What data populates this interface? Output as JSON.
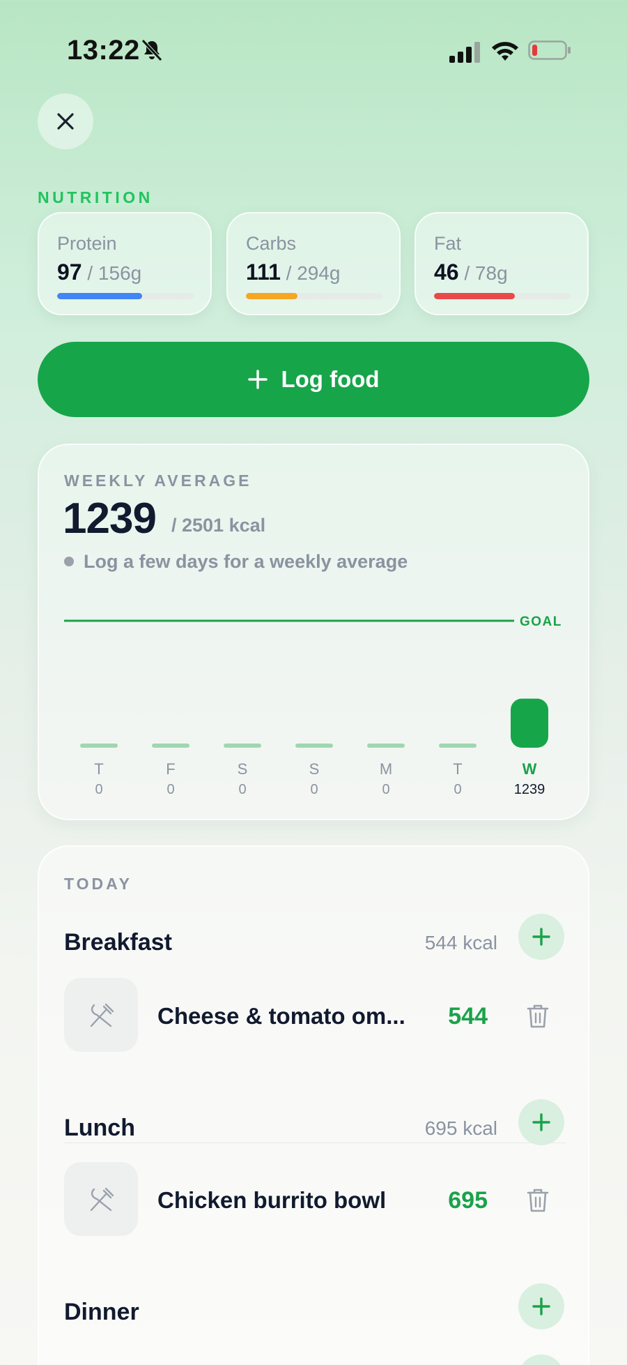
{
  "status_bar": {
    "time": "13:22"
  },
  "nutrition": {
    "label": "NUTRITION",
    "macros": [
      {
        "name": "Protein",
        "current": "97",
        "goal": " / 156g",
        "progress": 0.62,
        "color": "#4285f4"
      },
      {
        "name": "Carbs",
        "current": "111",
        "goal": " / 294g",
        "progress": 0.38,
        "color": "#f5a623"
      },
      {
        "name": "Fat",
        "current": "46",
        "goal": " / 78g",
        "progress": 0.59,
        "color": "#e84a4a"
      }
    ]
  },
  "log_food": {
    "label": "Log food"
  },
  "weekly": {
    "label": "WEEKLY AVERAGE",
    "value": "1239",
    "goal_text": "/ 2501 kcal",
    "hint": "Log a few days for a weekly average",
    "goal_marker": "GOAL",
    "chart_data": {
      "type": "bar",
      "categories": [
        "T",
        "F",
        "S",
        "S",
        "M",
        "T",
        "W"
      ],
      "values": [
        0,
        0,
        0,
        0,
        0,
        0,
        1239
      ],
      "value_labels": [
        "0",
        "0",
        "0",
        "0",
        "0",
        "0",
        "1239"
      ],
      "goal": 2501,
      "highlight_index": 6
    }
  },
  "today": {
    "label": "TODAY",
    "meals": [
      {
        "title": "Breakfast",
        "kcal": "544 kcal",
        "entries": [
          {
            "name": "Cheese & tomato om...",
            "kcal": "544"
          }
        ]
      },
      {
        "title": "Lunch",
        "kcal": "695 kcal",
        "entries": [
          {
            "name": "Chicken burrito bowl",
            "kcal": "695"
          }
        ]
      },
      {
        "title": "Dinner",
        "kcal": "",
        "entries": []
      }
    ]
  }
}
